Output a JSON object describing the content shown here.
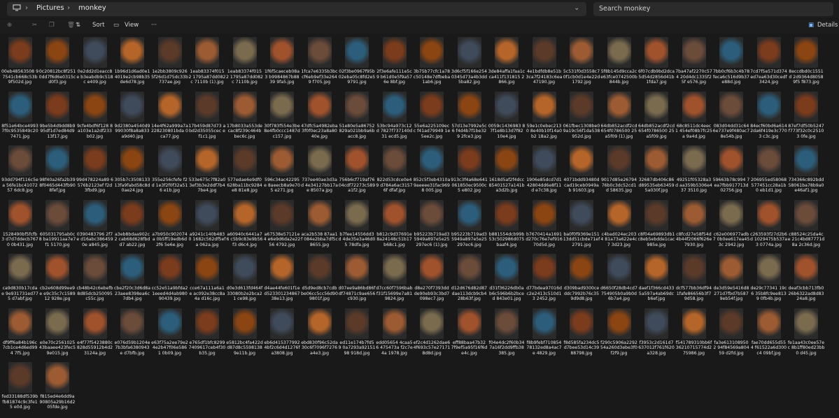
{
  "window": {
    "breadcrumb": [
      "Pictures",
      "monkey"
    ],
    "search_placeholder": "Search monkey"
  },
  "toolbar": {
    "sort_label": "Sort",
    "view_label": "View",
    "more_label": "···",
    "details_label": "Details"
  },
  "selection": [
    9,
    1
  ],
  "files": [
    [
      "00eb48563508 97541cb668c53b 9f502d.jpg",
      "0c20812bc8f251 0dd7f6d6e0315c d0f3.jpg",
      "0e2dd2d1eacc8e b3eabdb9c518c e409.jpg",
      "1b96d1d6ad0e1 4019e2cb98b35 de6d78.jpg",
      "1e2bb3809c926 5f26d1d75dc33b 737ae.jpg",
      "1eab83374f0152 1795a87dd082c 7110b (1).jpg",
      "1eab83374f0152 1795a87dd082c 7110b.jpg",
      "1f6f5caeceb08a3 b9984867b8839 9fa5.jpg",
      "1fca7e6335b3bc cf6eb9ef33e2649 f705.jpg",
      "02f3be0967f95b 02eba05c8fd2e5 9791.jpg",
      "2f3e6afe111e5c9 b61d0e5f9a576e 8bf.jpg",
      "3b75b77cfc1a78 c50148e7dfbeba 1ab6.jpg",
      "3d6cf5f166e254 0345d73a4b3dd 5ba82.jpg",
      "3de84affa1faa1c ca411f131815 2866.jpg",
      "4e1bdfdb8e51b 3ca7f24183c6ea 47190.jpg",
      "5c531f0d3558c7 0f1cb0d1e4e22d 1792.jpg",
      "5f8b145d9cca2c e63fce0742500b 844b.jpg",
      "6f07cdb9bd2dca 5d54d2856d41b 1fda7.jpg",
      "7ba47af2270c574 20d4dc1335f25f e576.jpg",
      "7bb0cf6b3c4b78 feca6c516d9b37 e88d.jpg",
      "7cd7f5e571d374 ed7ea63d30cedf 3424.jpg",
      "8eccdbd0c1551d 2d9364d80589f5 f873.jpg"
    ],
    [
      "8f51e64bce4993 7f0c9535849c20 7471.jpg",
      "9be5b4d9dd8b9 95df1d7ed84d9 13f17.jpg",
      "9cfe4bdf6f128 8a103e1a2df233 b02.jpg",
      "9d2380a4540d9 99030f8a8a833 a9d40.jpg",
      "14e4f62a999a7a 228230801bda 0ca77.jpg",
      "17b459d87d73 abd2d35055cec ef1c1.jpg",
      "17b8033a553de cac8f239c464b bec6c.jpg",
      "30f783f554e3be 8e4fb0ccc1487d c157.jpg",
      "47dfc5a4982eba 3f0f0ec23a8a80 40e.jpg",
      "51e80e5a86752 829a021bb9a6b acc8.jpg",
      "53bc94a973c12d 7827f737140d31 ecd5.jpg",
      "55e6a225109ecc f41ad79949 1e5ee2c.jpg",
      "57d13e7992e5c6 f4d4b7f1be329 2fce3.jpg",
      "0059c1436983 87f1e8b13d7f82 10e4.jpg",
      "59e1c0ebec2130 8e40b10f14a0b2 18a2.jpg",
      "061fbec1308be0 9a19c56f1da538 952d.jpg",
      "64db852acdf2cd 654f0786500 25a5f09 (1).jpg",
      "64db852acdf2cd 654f0786500 25a5f09.jpg",
      "68c8511dc4eec1 454ef08b7fc25a 9a4d.jpg",
      "083d04dd31c64 6e737e9f480ac7 8e54b.jpg",
      "84ecf60bd6a614 2da6f419e3c7703 c3c.jpg",
      "87ef7df50b5247 f773f32c0c2510 3 0fe.jpg"
    ],
    [
      "93dd794f116c5ea 56fe1bc4107257 6dc8.jpg",
      "98f40a26fa2b39 8f0465d443fb90 8fef.jpg",
      "99d478224a89 6576b2123ef f2d 3fbd9.jpg",
      "305b7c3508133 13fa9fabd58c8d 0ae24.jpg",
      "355e256cfefe f2d 1e3f2f0f32a516 e1b.jpg",
      "533e675c7f82a0 3ef3b3e2ddf7b4 7be4.jpg",
      "577edae6e9df0 628ba11bc9284e8 81e8.jpg",
      "596c34ac42295e 8aeecb8a9e705 e271.jpg",
      "737ee40ae3d3ad 4e34127bb17ae 8507a.jpg",
      "756b6cf719af76 04cdf72273c589 a1f2.jpg",
      "822d53cdce0e49 d784a6ac3157 6f dfaf.jpg",
      "852c5f3eb4310a 9aeeee31fac9698 005.jpg",
      "913c3f4a68e641 061850ec9500c5 e802.jpg",
      "1618d5af2f4dcc 85401527a141b a3d2b.jpg",
      "1906e85dcd7d1 42804dd6e8f11d e7c38.jpg",
      "4071bdd93480d cad19ceb0949ab 91603.jpg",
      "9017d85e26794 76b0c3dc52cd1d 58635.jpg",
      "32687db406c86 d89535eb63459 5a030f.jpg",
      "49251f05328a3d aa359b5306e437 3510.jpg",
      "59663b78c994 7ea7fbb917713d 02756.jpg",
      "206955ed58068 577451cc28a1b0 eb1d1.jpg",
      "734366c892bdd 58061ba78b9a0 e46af1.jpg"
    ],
    [
      "1528490bf5fcfb3 d7d7ddecb7670 0b431.jpg",
      "605031795ab0c8 ba19911aa7e7f1 5170.jpg",
      "0390483796 2f7e d16abc3864590e a845.jpg",
      "a3eb8bdaa902c2 cab68d628fbdd7 ab22.jpg",
      "a7b950c902074a 0b5ff19edb6d2f6 5e6e.jpg",
      "a9241c140b4830 1682c562df5efa 062a.jpg",
      "a60940c6441a76 c5b9c83e9b56f3 d6c4.jpg",
      "a67538e57121e4 e6e9d6da2e2256 4792.jpg",
      "aca2b538 87aa1f 084e2bba7df5c 8655.jpg",
      "b7fee14556dd3d 4de35e3a46d05 78dfa.jpg",
      "b812c9d37691e 8a24148c51b17 b68c1.jpg",
      "b95223b719ad3 5949a897e5e25 297ec6 (1).jpg",
      "b95223b719ad3 5949a897e5e25 297ec6.jpg",
      "b881554dcb99b 53c502986d075 baaf4.jpg",
      "b7670414a1691 d270c76e7ef916 70d5d.jpg",
      "ba0f0f9369e151 13dd51cbde71ef 2791.jpg",
      "c4bad024ec2034 81a73a622e4c7 3d23.jpg",
      "c8f04a69893db1 c8eb5ebdde1cac 985e.jpg",
      "c8fcd27e58f54d 4b44f2066f626e 7930.jpg",
      "c62e006977adb7 0b0ee617ea453c 2942.jpg",
      "c263593f27d2b6d 1029475b537a3 0774a.jpg",
      "c88524c25da4ce 21c4bd87771d8a 2c36d.jpg"
    ],
    [
      "ca9d830b17cdae 9e931731ed775 d7abf.jpg",
      "cb2e608d99ee9e e9c35c7c158912 928e.jpg",
      "cb48b42c6ebefb 8d85dcb250095 c55c.jpg",
      "cbe2f20c3d6d8a 23aee8398ea6c 7db4.jpg",
      "cc52e51a9bfda2 1eeed4d4ab980 90439.jpg",
      "cce67a111a6a1e ac092e38cc8a4a d16c.jpg",
      "d0e3d613fd464f 33080b2e2bca21 ce98.jpg",
      "d4ae44fe601f1e d523301234867 38e13.jpg",
      "d5d9ed8cb7cdb be06cc5cc56d90 9801f.jpg",
      "d07ee9a86bd86f df74871c9ae656 c930.jpg",
      "d7cc60f7596bab f31f15699e7a81 9824.jpg",
      "d8e270f7393dd de90eb93c3bd7 098ec7.jpg",
      "d12d676d82d87 dae113dcb9cb4 28b63f.jpg",
      "d31f36226db0a b6c596b6b2bced 843e01.jpg",
      "d77bdea97016d c2e2413c510d13 2452.jpg",
      "d309bad9300ce ddc7992b76c35 9d9d8.jpg",
      "d6650f28db4cd7 754905b0a9b0d 6b7a4.jpg",
      "daef1f366cd433 5a597a4ab69dc b6ef.jpg",
      "dcf577bb36df94 1fafe86656b3f7 9d58.jpg",
      "de3d59e5416d8 271d7fbd7b587 9eb54f.jpg",
      "de29c77341 19c6 35b8fc9ee8139 0fb4b.jpg",
      "deaf3cbb713fb0 26b6322ad8d83 24a8.jpg"
    ],
    [
      "df9ff6a84b196c 7cb1ce4d6ed994 7f5.jpg",
      "e0e70c2561025 43baaee423fec5 9e015.jpg",
      "e4f77f5423880c 828d55912b4d2 3124a.jpg",
      "e076d59b1204e 7b3bfa6380943e d7bfb.jpg",
      "e63f75a2ee79e2 4e2b47f06e5861 0b09.jpg",
      "e765df1bfc8299 7409617ceb4f30 b35.jpg",
      "e5812bc4fa422d d87d8c5598138 9e11b.jpg",
      "eb6d415377992 4bf2c6d4d1276f a3808.jpg",
      "ebd830f96c52da 30c6f7096f7276 a4e3.jpg",
      "ed11e174b7fd59 0a7293a9215198 918d.jpg",
      "edd05654 4caa56 475473a f2c7e4a 1978.jpg",
      "ef2c4d1262dae6 4f693c57e27171 8d8d.jpg",
      "eff88baa47b32 7f9ef5a95f16f6d e4c.jpg",
      "f04e4dc2f60b34 7a16f2dd9ffb38 385.jpg",
      "f8b9febf710854 78132ed8a4ac7e 4829.jpg",
      "f8d585fa234dc5 d7bee53d14c39 88798.jpg",
      "f290c5906a2292 54a260d3ebe3f0 f2f9.jpg",
      "f3953c2d161d7 637012f761f620 a328.jpg",
      "f541789310bb6f 36210715774d2 75986.jpg",
      "fa3e6131089502 94f84569a80459 d2fd.jpg",
      "fae70dd655d554 f61522a6d300c4 09bf.jpg",
      "fe1aa43c0ee57ec 8b1ff80ed23bb0 d45.jpg"
    ],
    [
      "fed33188df539b fb81874c9c3fe15 e0d.jpg",
      "f815ed4e6dd9a 90805a29b16d2 05fde.jpg"
    ]
  ]
}
